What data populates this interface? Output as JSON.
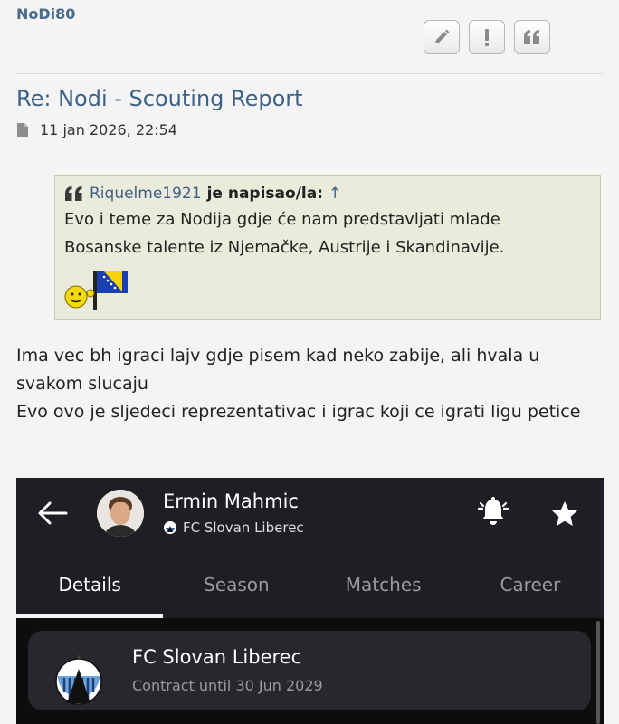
{
  "post": {
    "username": "NoDi80",
    "title": "Re: Nodi - Scouting Report",
    "date": "11 jan 2026, 22:54",
    "actions": [
      "edit-icon",
      "report-icon",
      "quote-icon"
    ]
  },
  "quote": {
    "author": "Riquelme1921",
    "said": "je napisao/la:",
    "arrow": "↑",
    "lines": [
      "Evo i teme za Nodija gdje će nam predstavljati mlade",
      "Bosanske talente iz Njemačke, Austrije i Skandinavije."
    ],
    "smiley": "smiley-flag-bosnia-icon"
  },
  "body": {
    "paragraph1": "Ima vec bh igraci lajv gdje pisem kad neko zabije, ali hvala u svakom slucaju",
    "paragraph2": "Evo ovo je sljedeci reprezentativac i igrac koji ce igrati ligu petice"
  },
  "app": {
    "player_name": "Ermin Mahmic",
    "team": "FC Slovan Liberec",
    "tabs": [
      "Details",
      "Season",
      "Matches",
      "Career"
    ],
    "active_tab": "Details",
    "card": {
      "club": "FC Slovan Liberec",
      "contract": "Contract until 30 Jun 2029"
    },
    "icons": [
      "back-arrow-icon",
      "bell-icon",
      "star-icon"
    ]
  },
  "colors": {
    "link": "#3d6186",
    "quote_bg": "#ebebdc",
    "app_header_bg": "#1d1f25",
    "app_bg": "#0d0d0d"
  }
}
